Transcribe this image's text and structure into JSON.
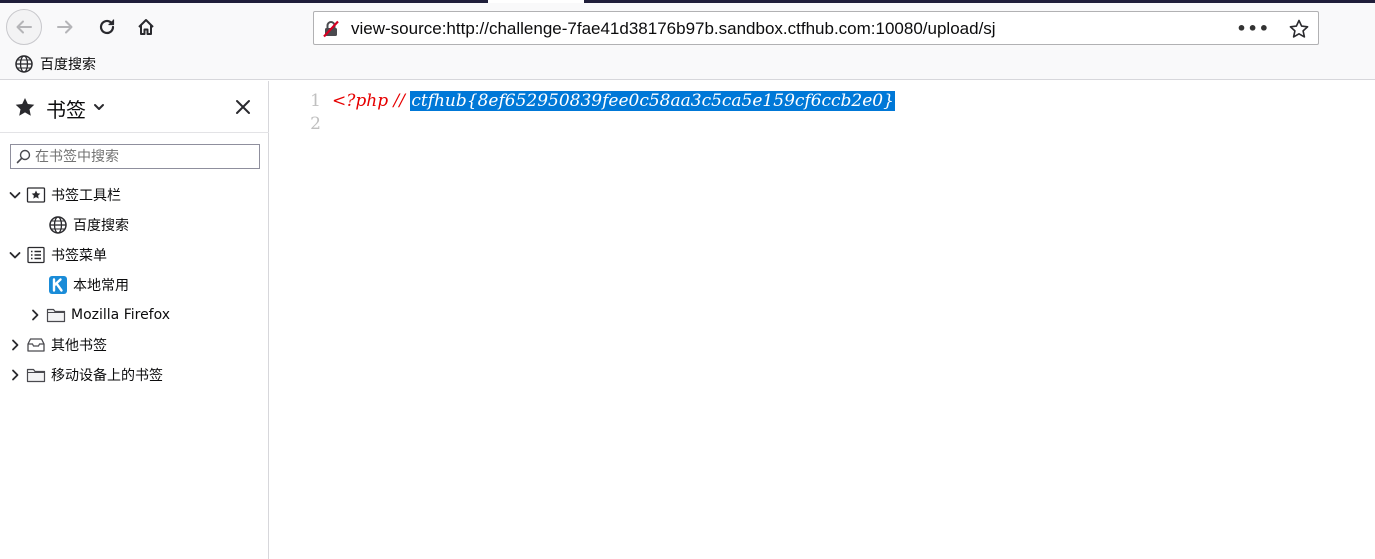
{
  "tab_strip": {
    "colors": [
      "#1f1e3a",
      "#3a3960",
      "#ffffff"
    ]
  },
  "navbar": {
    "back_icon": "arrow-left-icon",
    "forward_icon": "arrow-right-icon",
    "reload_icon": "reload-icon",
    "home_icon": "home-icon",
    "url": "view-source:http://challenge-7fae41d38176b97b.sandbox.ctfhub.com:10080/upload/sj",
    "page_actions_label": "•••",
    "bookmark_star_icon": "star-outline-icon"
  },
  "bookmarks_toolbar": {
    "items": [
      {
        "label": "百度搜索",
        "icon": "globe-icon"
      }
    ]
  },
  "sidebar": {
    "title": "书签",
    "search_placeholder": "在书签中搜索",
    "tree": [
      {
        "label": "书签工具栏",
        "expanded": true,
        "icon": "bookmark-toolbar-icon"
      },
      {
        "label": "百度搜索",
        "icon": "globe-icon"
      },
      {
        "label": "书签菜单",
        "expanded": true,
        "icon": "bookmark-menu-icon"
      },
      {
        "label": "本地常用",
        "icon": "k-app-icon"
      },
      {
        "label": "Mozilla Firefox",
        "expanded": false,
        "icon": "folder-icon"
      },
      {
        "label": "其他书签",
        "expanded": false,
        "icon": "other-bookmarks-icon"
      },
      {
        "label": "移动设备上的书签",
        "expanded": false,
        "icon": "folder-icon"
      }
    ]
  },
  "source_view": {
    "lines": [
      {
        "number": "1",
        "prefix": "<?php // ",
        "selected": "ctfhub{8ef652950839fee0c58aa3c5ca5e159cf6ccb2e0}"
      },
      {
        "number": "2",
        "prefix": "",
        "selected": ""
      }
    ],
    "colors": {
      "code": "#e60000",
      "selection_bg": "#0078d7",
      "line_number": "#c0c0c0"
    }
  }
}
